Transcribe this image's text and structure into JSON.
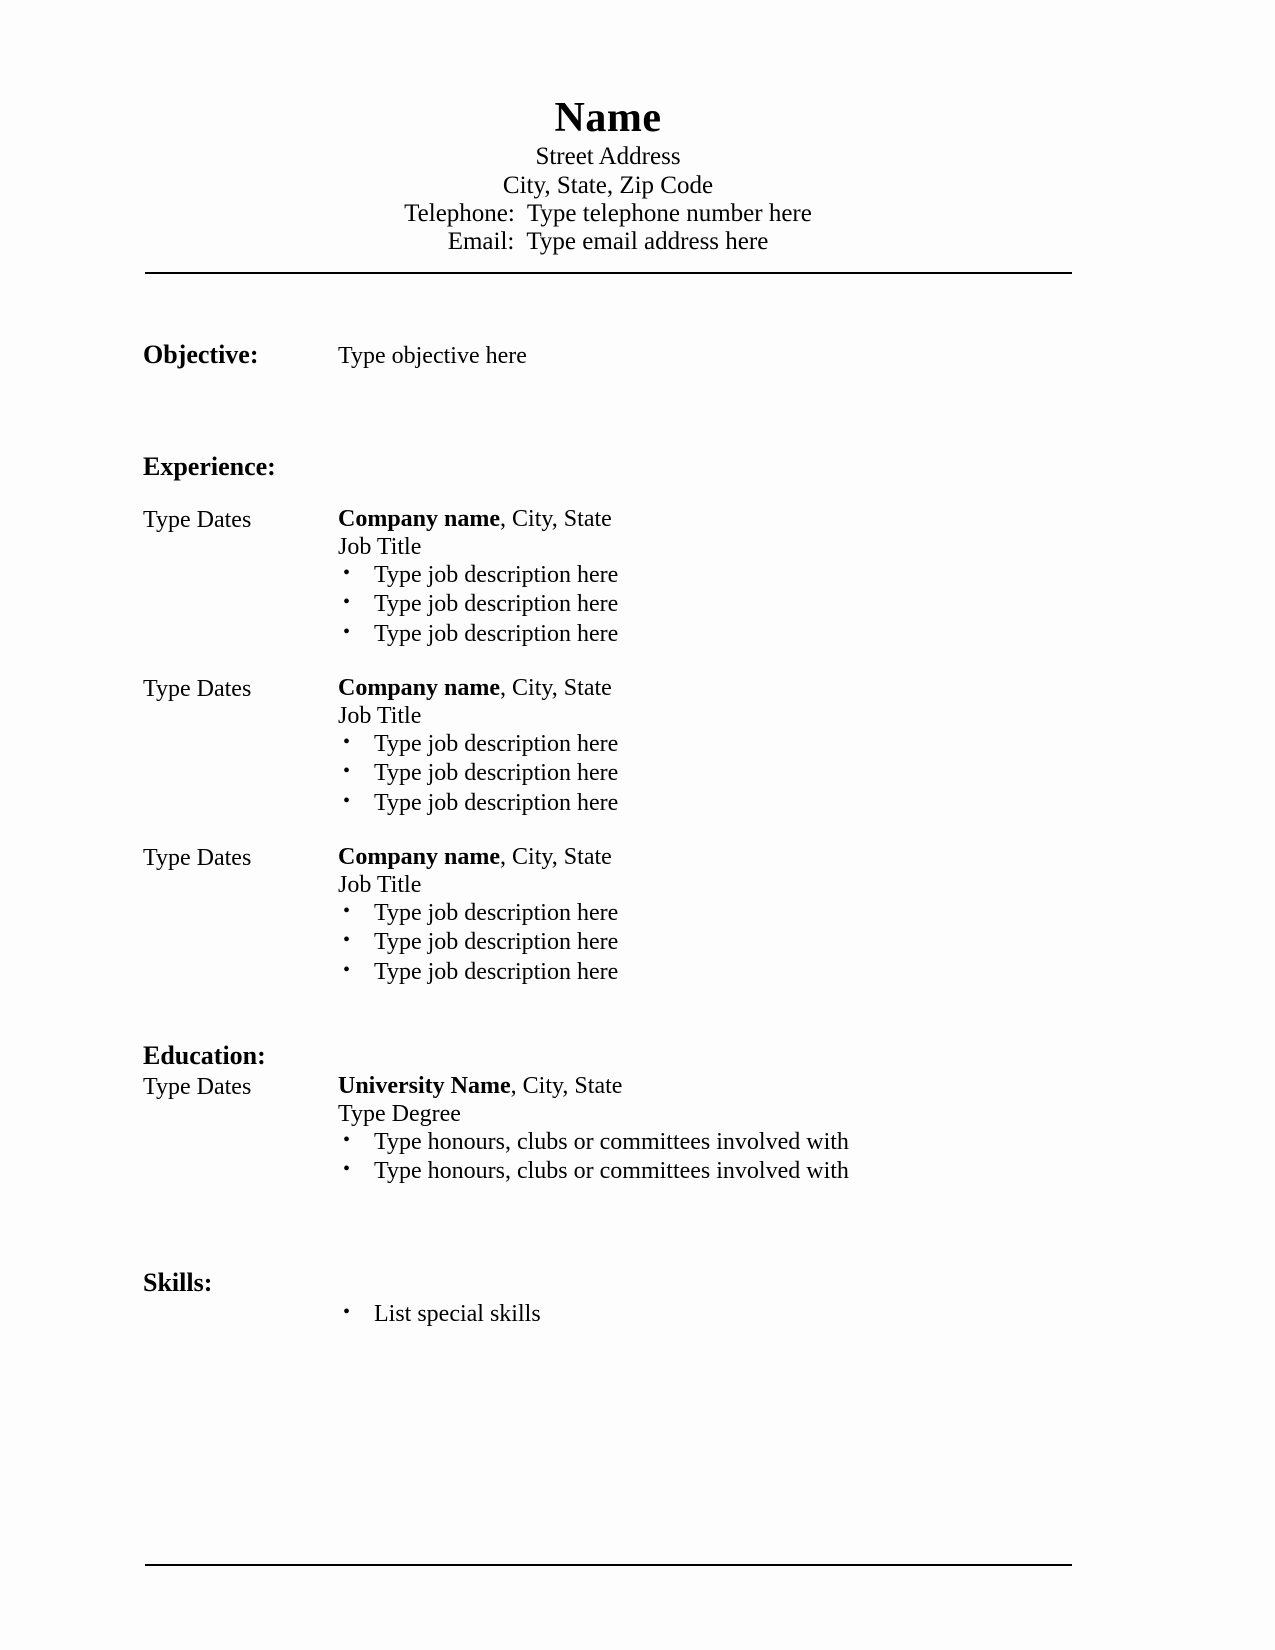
{
  "header": {
    "name": "Name",
    "street_address": "Street Address",
    "city_state_zip": "City, State, Zip Code",
    "telephone": "Telephone:  Type telephone number here",
    "email": "Email:  Type email address here"
  },
  "objective": {
    "heading": "Objective:",
    "text": "Type objective here"
  },
  "experience": {
    "heading": "Experience:",
    "entries": [
      {
        "dates": "Type Dates",
        "org": "Company name",
        "location": ", City, State",
        "role": "Job Title",
        "bullets": [
          "Type job description here",
          "Type job description here",
          "Type job description here"
        ]
      },
      {
        "dates": "Type Dates",
        "org": "Company name",
        "location": ", City, State",
        "role": "Job Title",
        "bullets": [
          "Type job description here",
          "Type job description here",
          "Type job description here"
        ]
      },
      {
        "dates": "Type Dates",
        "org": "Company name",
        "location": ", City, State",
        "role": "Job Title",
        "bullets": [
          "Type job description here",
          "Type job description here",
          "Type job description here"
        ]
      }
    ]
  },
  "education": {
    "heading": "Education:",
    "entries": [
      {
        "dates": "Type Dates",
        "org": "University Name",
        "location": ", City, State",
        "role": "Type Degree",
        "bullets": [
          "Type honours, clubs or committees involved with",
          "Type honours, clubs or committees involved with"
        ]
      }
    ]
  },
  "skills": {
    "heading": "Skills:",
    "bullets": [
      "List special skills"
    ]
  },
  "bullet_glyph": "•"
}
